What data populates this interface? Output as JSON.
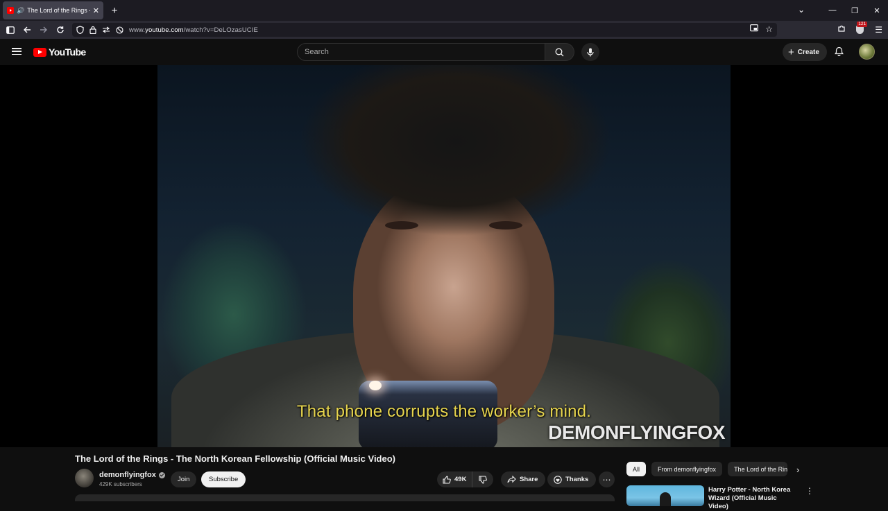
{
  "browser": {
    "tab_title": "The Lord of the Rings - The North Korean Fellowship (Official Music Video)",
    "url_prefix": "www.",
    "url_main": "youtube.com",
    "url_path": "/watch?v=DeLOzasUCIE",
    "ext_count": "121"
  },
  "header": {
    "logo_text": "YouTube",
    "search_placeholder": "Search",
    "create_label": "Create"
  },
  "player": {
    "subtitle": "That phone corrupts the worker’s mind.",
    "watermark": "DEMONFLYINGFOX"
  },
  "video": {
    "title": "The Lord of the Rings - The North Korean Fellowship (Official Music Video)",
    "channel_name": "demonflyingfox",
    "subscribers": "429K subscribers",
    "join_label": "Join",
    "subscribe_label": "Subscribe",
    "likes": "49K",
    "share_label": "Share",
    "thanks_label": "Thanks"
  },
  "sidebar": {
    "chips": [
      "All",
      "From demonflyingfox",
      "The Lord of the Rings"
    ],
    "rec_title": "Harry Potter - North Korea Wizard (Official Music Video)"
  },
  "colors": {
    "accent": "#ff0000",
    "subtitle": "#e7d54e",
    "background": "#0f0f0f"
  }
}
